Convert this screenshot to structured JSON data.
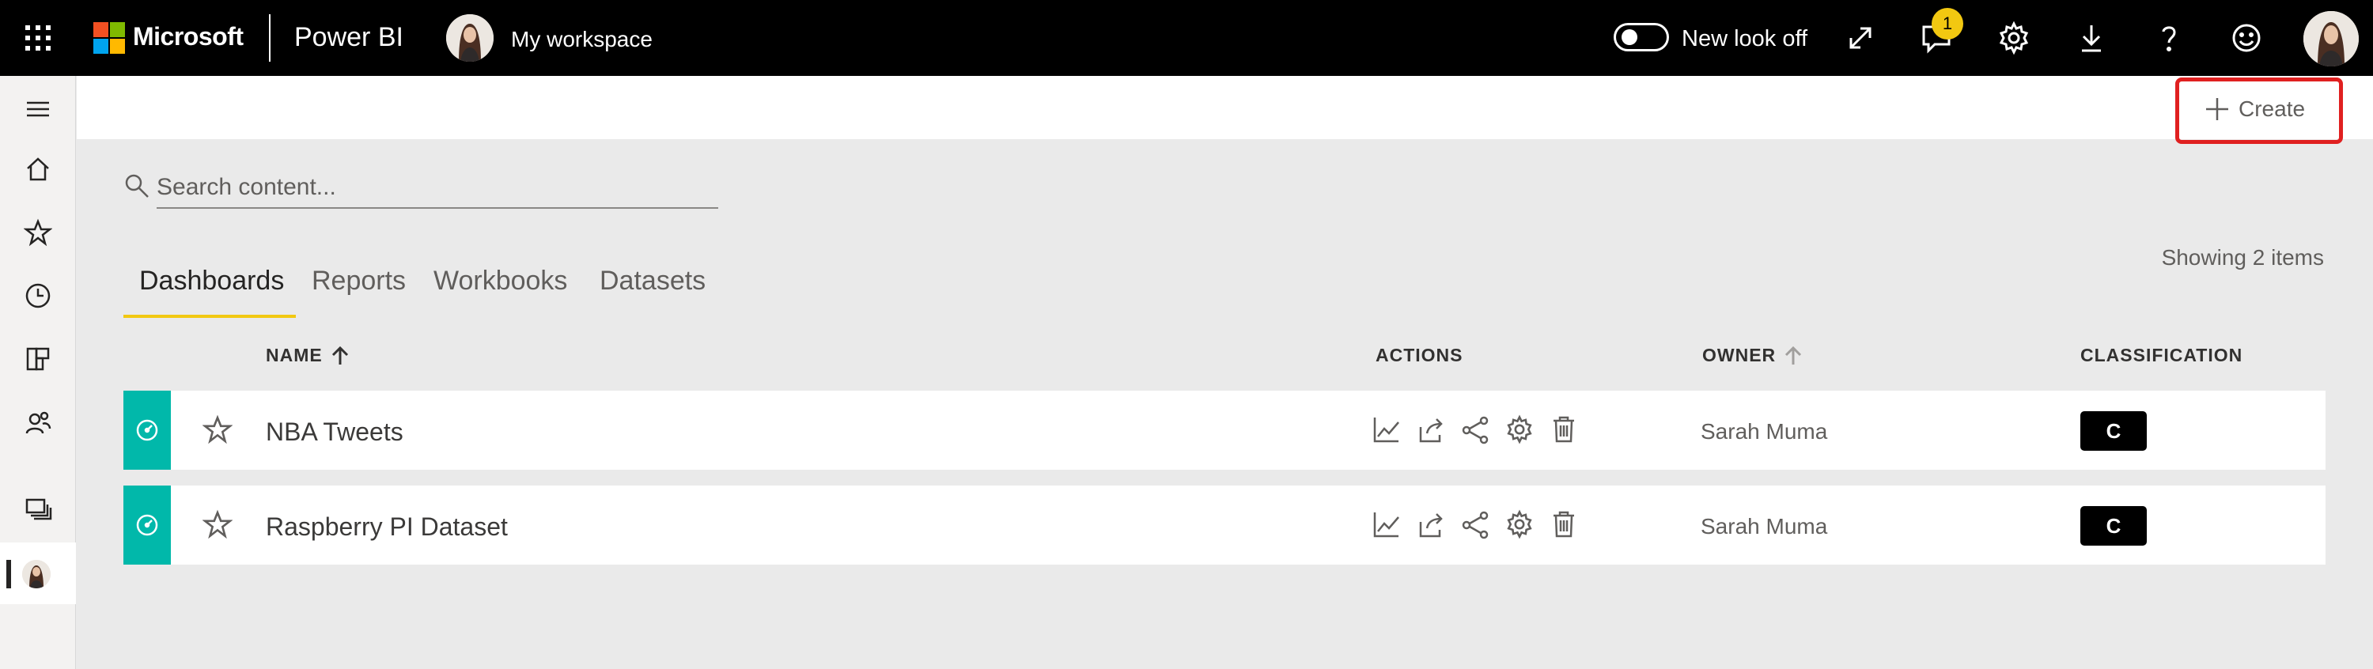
{
  "topbar": {
    "brand": "Microsoft",
    "app_name": "Power BI",
    "workspace": "My workspace",
    "new_look_label": "New look off",
    "notification_count": "1"
  },
  "leftnav": {
    "items": [
      "hamburger-icon",
      "home-icon",
      "star-icon",
      "recent-clock-icon",
      "apps-icon",
      "shared-people-icon",
      "workspaces-icon",
      "my-workspace-avatar"
    ]
  },
  "command_bar": {
    "create_label": "Create"
  },
  "search": {
    "placeholder": "Search content..."
  },
  "showing": "Showing 2 items",
  "tabs": [
    {
      "label": "Dashboards",
      "active": true
    },
    {
      "label": "Reports",
      "active": false
    },
    {
      "label": "Workbooks",
      "active": false
    },
    {
      "label": "Datasets",
      "active": false
    }
  ],
  "table": {
    "headers": {
      "name": "NAME",
      "actions": "ACTIONS",
      "owner": "OWNER",
      "classification": "CLASSIFICATION"
    },
    "rows": [
      {
        "name": "NBA Tweets",
        "owner": "Sarah Muma",
        "classification": "C"
      },
      {
        "name": "Raspberry PI Dataset",
        "owner": "Sarah Muma",
        "classification": "C"
      }
    ]
  },
  "colors": {
    "topbar": "#000000",
    "accent_yellow": "#f2c811",
    "dashboard_teal": "#01b8aa",
    "highlight_red": "#e02020"
  }
}
